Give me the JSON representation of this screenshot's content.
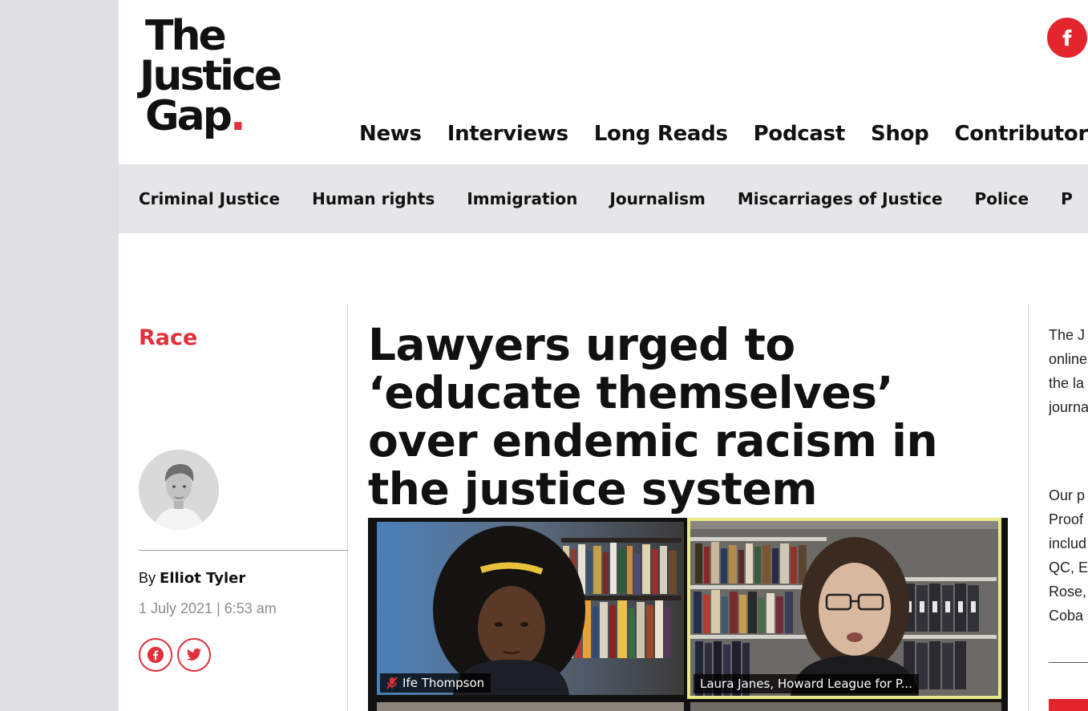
{
  "header": {
    "logo": {
      "line1": "The",
      "line2": "Justice",
      "line3": "Gap",
      "dot": "."
    },
    "facebook_icon": "facebook-icon"
  },
  "main_nav": [
    {
      "label": "News"
    },
    {
      "label": "Interviews"
    },
    {
      "label": "Long Reads"
    },
    {
      "label": "Podcast"
    },
    {
      "label": "Shop"
    },
    {
      "label": "Contributors"
    }
  ],
  "category_nav": [
    {
      "label": "Criminal Justice"
    },
    {
      "label": "Human rights"
    },
    {
      "label": "Immigration"
    },
    {
      "label": "Journalism"
    },
    {
      "label": "Miscarriages of Justice"
    },
    {
      "label": "Police"
    },
    {
      "label": "P"
    }
  ],
  "article": {
    "category": "Race",
    "headline": "Lawyers urged to ‘educate themselves’ over endemic racism in the justice system",
    "byline_prefix": "By",
    "author": "Elliot Tyler",
    "date": "1 July 2021 | 6:53 am",
    "video": {
      "participants": [
        {
          "name": "Ife Thompson",
          "muted": true
        },
        {
          "name": "Laura Janes, Howard League for P...",
          "muted": false
        }
      ]
    }
  },
  "sidebar": {
    "para1": [
      "The J",
      "online",
      "the la",
      "journa"
    ],
    "para2": [
      "Our p",
      "Proof",
      "includ",
      "QC, E",
      "Rose,",
      "Coba"
    ]
  },
  "colors": {
    "accent": "#e0303a",
    "facebook_red": "#e3262e",
    "category_bar": "#e6e6e8",
    "speaker_highlight": "#e7e98a"
  }
}
